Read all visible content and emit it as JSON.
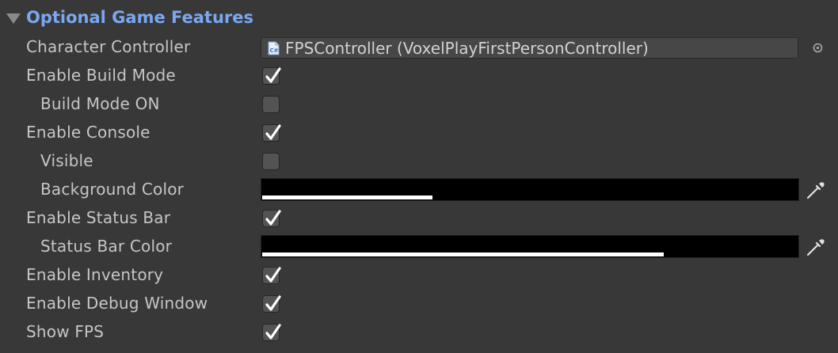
{
  "section": {
    "title": "Optional Game Features"
  },
  "fields": {
    "character_controller": {
      "label": "Character Controller",
      "value": "FPSController (VoxelPlayFirstPersonController)",
      "icon": "csharp-script-icon"
    },
    "enable_build_mode": {
      "label": "Enable Build Mode",
      "checked": true
    },
    "build_mode_on": {
      "label": "Build Mode ON",
      "checked": false
    },
    "enable_console": {
      "label": "Enable Console",
      "checked": true
    },
    "visible": {
      "label": "Visible",
      "checked": false
    },
    "background_color": {
      "label": "Background Color",
      "color": "#000000",
      "alpha": 0.32
    },
    "enable_status_bar": {
      "label": "Enable Status Bar",
      "checked": true
    },
    "status_bar_color": {
      "label": "Status Bar Color",
      "color": "#000000",
      "alpha": 0.75
    },
    "enable_inventory": {
      "label": "Enable Inventory",
      "checked": true
    },
    "enable_debug_window": {
      "label": "Enable Debug Window",
      "checked": true
    },
    "show_fps": {
      "label": "Show FPS",
      "checked": true
    }
  },
  "colors": {
    "header_text": "#7aa7f0",
    "background": "#383838",
    "label_text": "#c6c6c6"
  }
}
